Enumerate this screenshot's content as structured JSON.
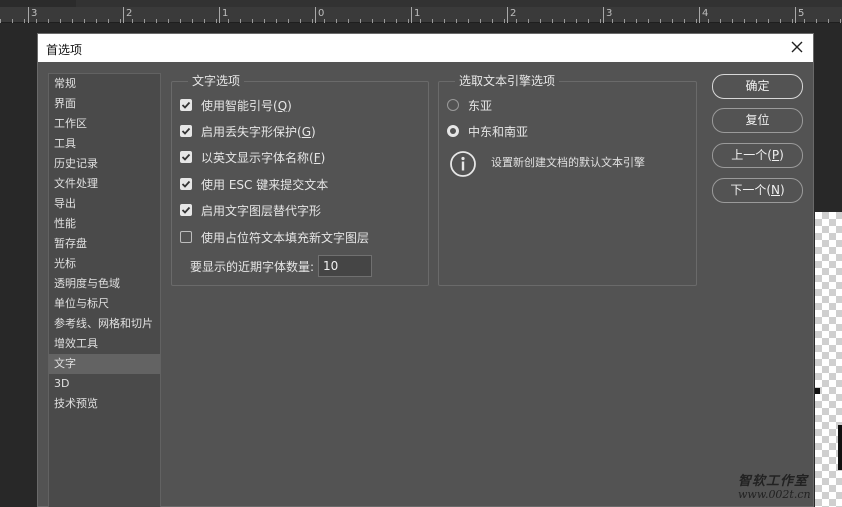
{
  "ruler": {
    "numbers": [
      "3",
      "2",
      "1",
      "0",
      "1",
      "2",
      "3",
      "4",
      "5"
    ]
  },
  "dialog": {
    "title": "首选项",
    "close_icon": "close-icon"
  },
  "sidebar": {
    "active_index": 14,
    "items": [
      {
        "label": "常规"
      },
      {
        "label": "界面"
      },
      {
        "label": "工作区"
      },
      {
        "label": "工具"
      },
      {
        "label": "历史记录"
      },
      {
        "label": "文件处理"
      },
      {
        "label": "导出"
      },
      {
        "label": "性能"
      },
      {
        "label": "暂存盘"
      },
      {
        "label": "光标"
      },
      {
        "label": "透明度与色域"
      },
      {
        "label": "单位与标尺"
      },
      {
        "label": "参考线、网格和切片"
      },
      {
        "label": "增效工具"
      },
      {
        "label": "文字"
      },
      {
        "label": "3D"
      },
      {
        "label": "技术预览"
      }
    ]
  },
  "type_options": {
    "legend": "文字选项",
    "options": [
      {
        "label": "使用智能引号(",
        "key": "Q",
        "suffix": ")",
        "checked": true
      },
      {
        "label": "启用丢失字形保护(",
        "key": "G",
        "suffix": ")",
        "checked": true
      },
      {
        "label": "以英文显示字体名称(",
        "key": "F",
        "suffix": ")",
        "checked": true
      },
      {
        "label": "使用 ESC 键来提交文本",
        "key": "",
        "suffix": "",
        "checked": true
      },
      {
        "label": "启用文字图层替代字形",
        "key": "",
        "suffix": "",
        "checked": true
      },
      {
        "label": "使用占位符文本填充新文字图层",
        "key": "",
        "suffix": "",
        "checked": false
      }
    ],
    "recent_fonts_label": "要显示的近期字体数量:",
    "recent_fonts_value": "10"
  },
  "engine_options": {
    "legend": "选取文本引擎选项",
    "radios": [
      {
        "label": "东亚",
        "selected": false
      },
      {
        "label": "中东和南亚",
        "selected": true
      }
    ],
    "info_icon": "info-icon",
    "info_text": "设置新创建文档的默认文本引擎"
  },
  "buttons": {
    "ok": "确定",
    "reset": "复位",
    "prev_label": "上一个(",
    "prev_key": "P",
    "prev_suffix": ")",
    "next_label": "下一个(",
    "next_key": "N",
    "next_suffix": ")"
  },
  "watermark": {
    "title": "智软工作室",
    "url": "www.002t.cn"
  },
  "colors": {
    "dialog_bg": "#535353",
    "sidebar_bg": "#4a4a4a",
    "sidebar_active": "#636363",
    "titlebar_bg": "#ffffff"
  }
}
